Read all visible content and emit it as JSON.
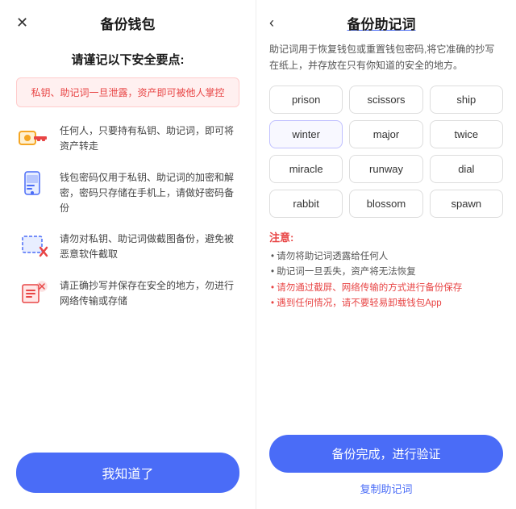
{
  "left": {
    "close_icon": "✕",
    "title": "备份钱包",
    "section_title": "请谨记以下安全要点:",
    "warning": "私钥、助记词一旦泄露，资产即可被他人掌控",
    "items": [
      {
        "icon": "🔑",
        "text": "任何人，只要持有私钥、助记词，即可将资产转走"
      },
      {
        "icon": "📱",
        "text": "钱包密码仅用于私钥、助记词的加密和解密，密码只存储在手机上，请做好密码备份"
      },
      {
        "icon": "📷",
        "text": "请勿对私钥、助记词做截图备份，避免被恶意软件截取"
      },
      {
        "icon": "📋",
        "text": "请正确抄写并保存在安全的地方，勿进行网络传输或存储"
      }
    ],
    "confirm_btn": "我知道了"
  },
  "right": {
    "back_icon": "‹",
    "title": "备份助记词",
    "desc": "助记词用于恢复钱包或重置钱包密码,将它准确的抄写在纸上，并存放在只有你知道的安全的地方。",
    "words": [
      "prison",
      "scissors",
      "ship",
      "winter",
      "major",
      "twice",
      "miracle",
      "runway",
      "dial",
      "rabbit",
      "blossom",
      "spawn"
    ],
    "highlighted_word": "winter",
    "notice_title": "注意:",
    "notices": [
      {
        "text": "请勿将助记词透露给任何人",
        "red": false
      },
      {
        "text": "助记词一旦丢失，资产将无法恢复",
        "red": false
      },
      {
        "text": "请勿通过截屏、网络传输的方式进行备份保存",
        "red": true
      },
      {
        "text": "遇到任何情况，请不要轻易卸载钱包App",
        "red": true
      }
    ],
    "backup_btn": "备份完成，进行验证",
    "copy_link": "复制助记词"
  }
}
